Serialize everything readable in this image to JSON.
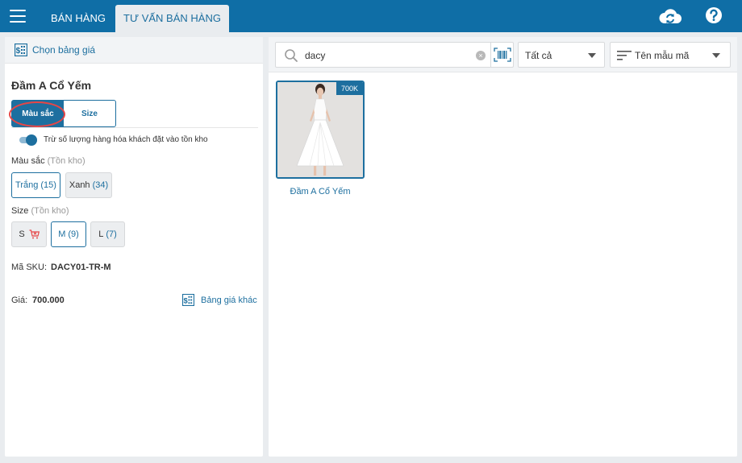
{
  "topbar": {
    "tabs": [
      {
        "label": "BÁN HÀNG",
        "active": false
      },
      {
        "label": "TƯ VẤN BÁN HÀNG",
        "active": true
      }
    ],
    "icons": [
      "menu-icon",
      "cloud-sync-icon",
      "help-icon"
    ]
  },
  "left": {
    "price_list_label": "Chọn bảng giá",
    "product_title": "Đầm A Cổ Yếm",
    "segments": {
      "color": "Màu sắc",
      "size": "Size",
      "active": "color"
    },
    "toggle": {
      "label": "Trừ số lượng hàng hóa khách đặt vào tồn kho",
      "on": true
    },
    "color_section": {
      "label": "Màu sắc",
      "sub": "(Tồn kho)"
    },
    "colors": [
      {
        "name": "Trắng",
        "count": "(15)",
        "selected": true
      },
      {
        "name": "Xanh",
        "count": "(34)",
        "selected": false
      }
    ],
    "size_section": {
      "label": "Size",
      "sub": "(Tồn kho)"
    },
    "sizes": [
      {
        "name": "S",
        "count": "",
        "out_of_stock": true,
        "selected": false
      },
      {
        "name": "M",
        "count": "(9)",
        "selected": true
      },
      {
        "name": "L",
        "count": "(7)",
        "selected": false
      }
    ],
    "sku_label": "Mã SKU:",
    "sku_value": "DACY01-TR-M",
    "price_label": "Giá:",
    "price_value": "700.000",
    "other_price_label": "Bảng giá khác"
  },
  "right": {
    "search": {
      "value": "dacy",
      "placeholder": ""
    },
    "filter": {
      "selected": "Tất cả"
    },
    "sort": {
      "selected": "Tên mẫu mã"
    },
    "products": [
      {
        "name": "Đầm A Cổ Yếm",
        "price_badge": "700K"
      }
    ]
  },
  "colors": {
    "primary": "#0f6ea6",
    "accent": "#1d6f9f",
    "highlight_ring": "#e64646",
    "out_of_stock": "#e64646"
  }
}
